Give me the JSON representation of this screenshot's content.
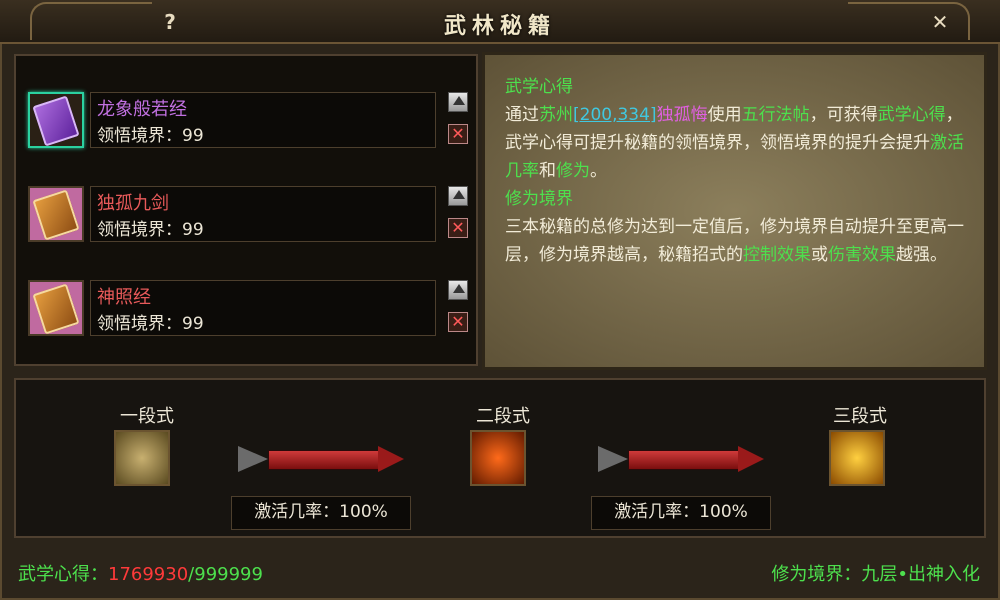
{
  "window": {
    "title": "武林秘籍",
    "help_label": "?",
    "close_label": "✕"
  },
  "books": [
    {
      "name": "龙象般若经",
      "name_color": "#c070e0",
      "level": "领悟境界：99",
      "selected": true,
      "cover": "purple-book-icon"
    },
    {
      "name": "独孤九剑",
      "name_color": "#e85a5a",
      "level": "领悟境界：99",
      "selected": false,
      "cover": "orange-book-icon"
    },
    {
      "name": "神照经",
      "name_color": "#e85a5a",
      "level": "领悟境界：99",
      "selected": false,
      "cover": "orange-book-icon"
    }
  ],
  "info": {
    "section1_title": "武学心得",
    "p1_a": "通过",
    "p1_loc": "苏州",
    "p1_coord": "[200,334]",
    "p1_npc": "独孤悔",
    "p1_b": "使用",
    "p1_item": "五行法帖",
    "p1_c": "，可获得",
    "p1_term": "武学心得",
    "p1_d": "，武学心得可提升秘籍的领悟境界，领悟境界的提升会提升",
    "p1_act": "激活几率",
    "p1_e": "和",
    "p1_cult": "修为",
    "p1_f": "。",
    "section2_title": "修为境界",
    "p2_a": "三本秘籍的总修为达到一定值后，修为境界自动提升至更高一层，修为境界越高，秘籍招式的",
    "p2_ctrl": "控制效果",
    "p2_b": "或",
    "p2_dmg": "伤害效果",
    "p2_c": "越强。"
  },
  "stages": [
    {
      "label": "一段式",
      "icon": "elephant-skill-icon"
    },
    {
      "label": "二段式",
      "icon": "dragon-skill-icon"
    },
    {
      "label": "三段式",
      "icon": "golden-dragon-skill-icon"
    }
  ],
  "rates": [
    "激活几率：100%",
    "激活几率：100%"
  ],
  "footer": {
    "insight_label": "武学心得：",
    "insight_value": "1769930",
    "insight_max": "/999999",
    "realm": "修为境界：九层•出神入化"
  }
}
